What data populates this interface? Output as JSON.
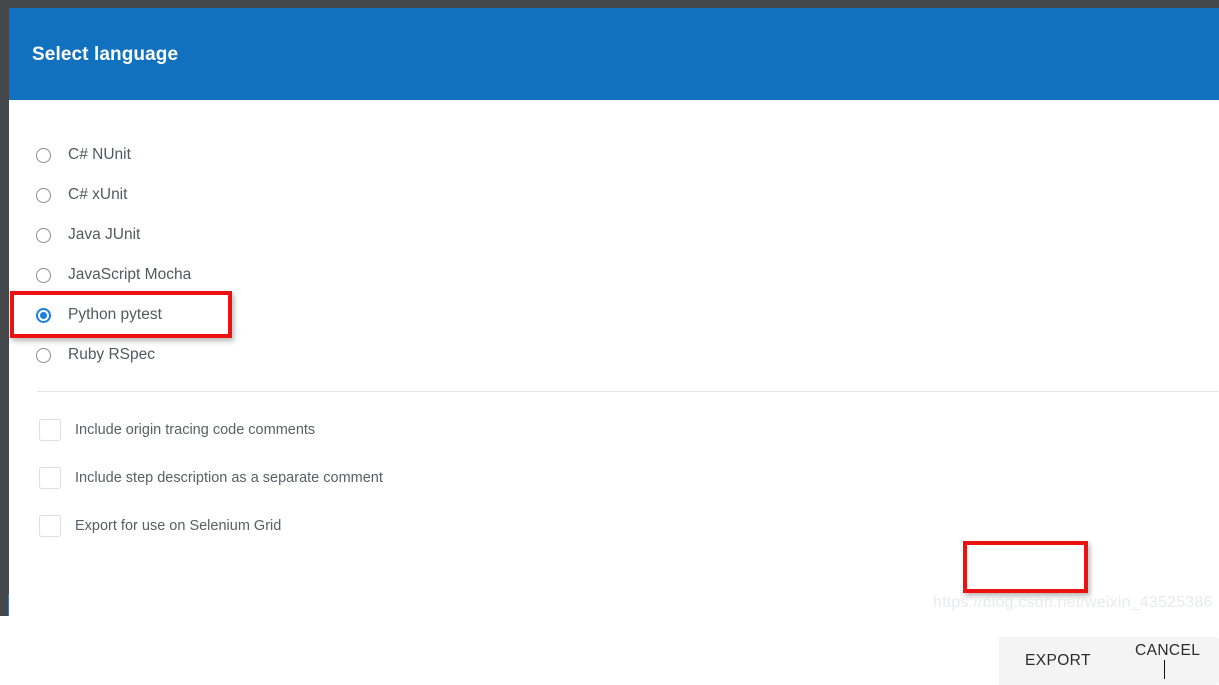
{
  "dialog": {
    "title": "Select language",
    "header_color": "#1271bf"
  },
  "languages": {
    "options": [
      {
        "label": "C# NUnit",
        "selected": false
      },
      {
        "label": "C# xUnit",
        "selected": false
      },
      {
        "label": "Java JUnit",
        "selected": false
      },
      {
        "label": "JavaScript Mocha",
        "selected": false
      },
      {
        "label": "Python pytest",
        "selected": true
      },
      {
        "label": "Ruby RSpec",
        "selected": false
      }
    ],
    "selected_value": "Python pytest"
  },
  "options": {
    "checkboxes": [
      {
        "label": "Include origin tracing code comments",
        "checked": false
      },
      {
        "label": "Include step description as a separate comment",
        "checked": false
      },
      {
        "label": "Export for use on Selenium Grid",
        "checked": false
      }
    ]
  },
  "actions": {
    "export_label": "EXPORT",
    "cancel_label": "CANCEL"
  },
  "annotations": {
    "color": "#ee1111",
    "targets": [
      "Python pytest",
      "EXPORT"
    ]
  },
  "watermark": {
    "text": "https://blog.csdn.net/weixin_43525386"
  }
}
